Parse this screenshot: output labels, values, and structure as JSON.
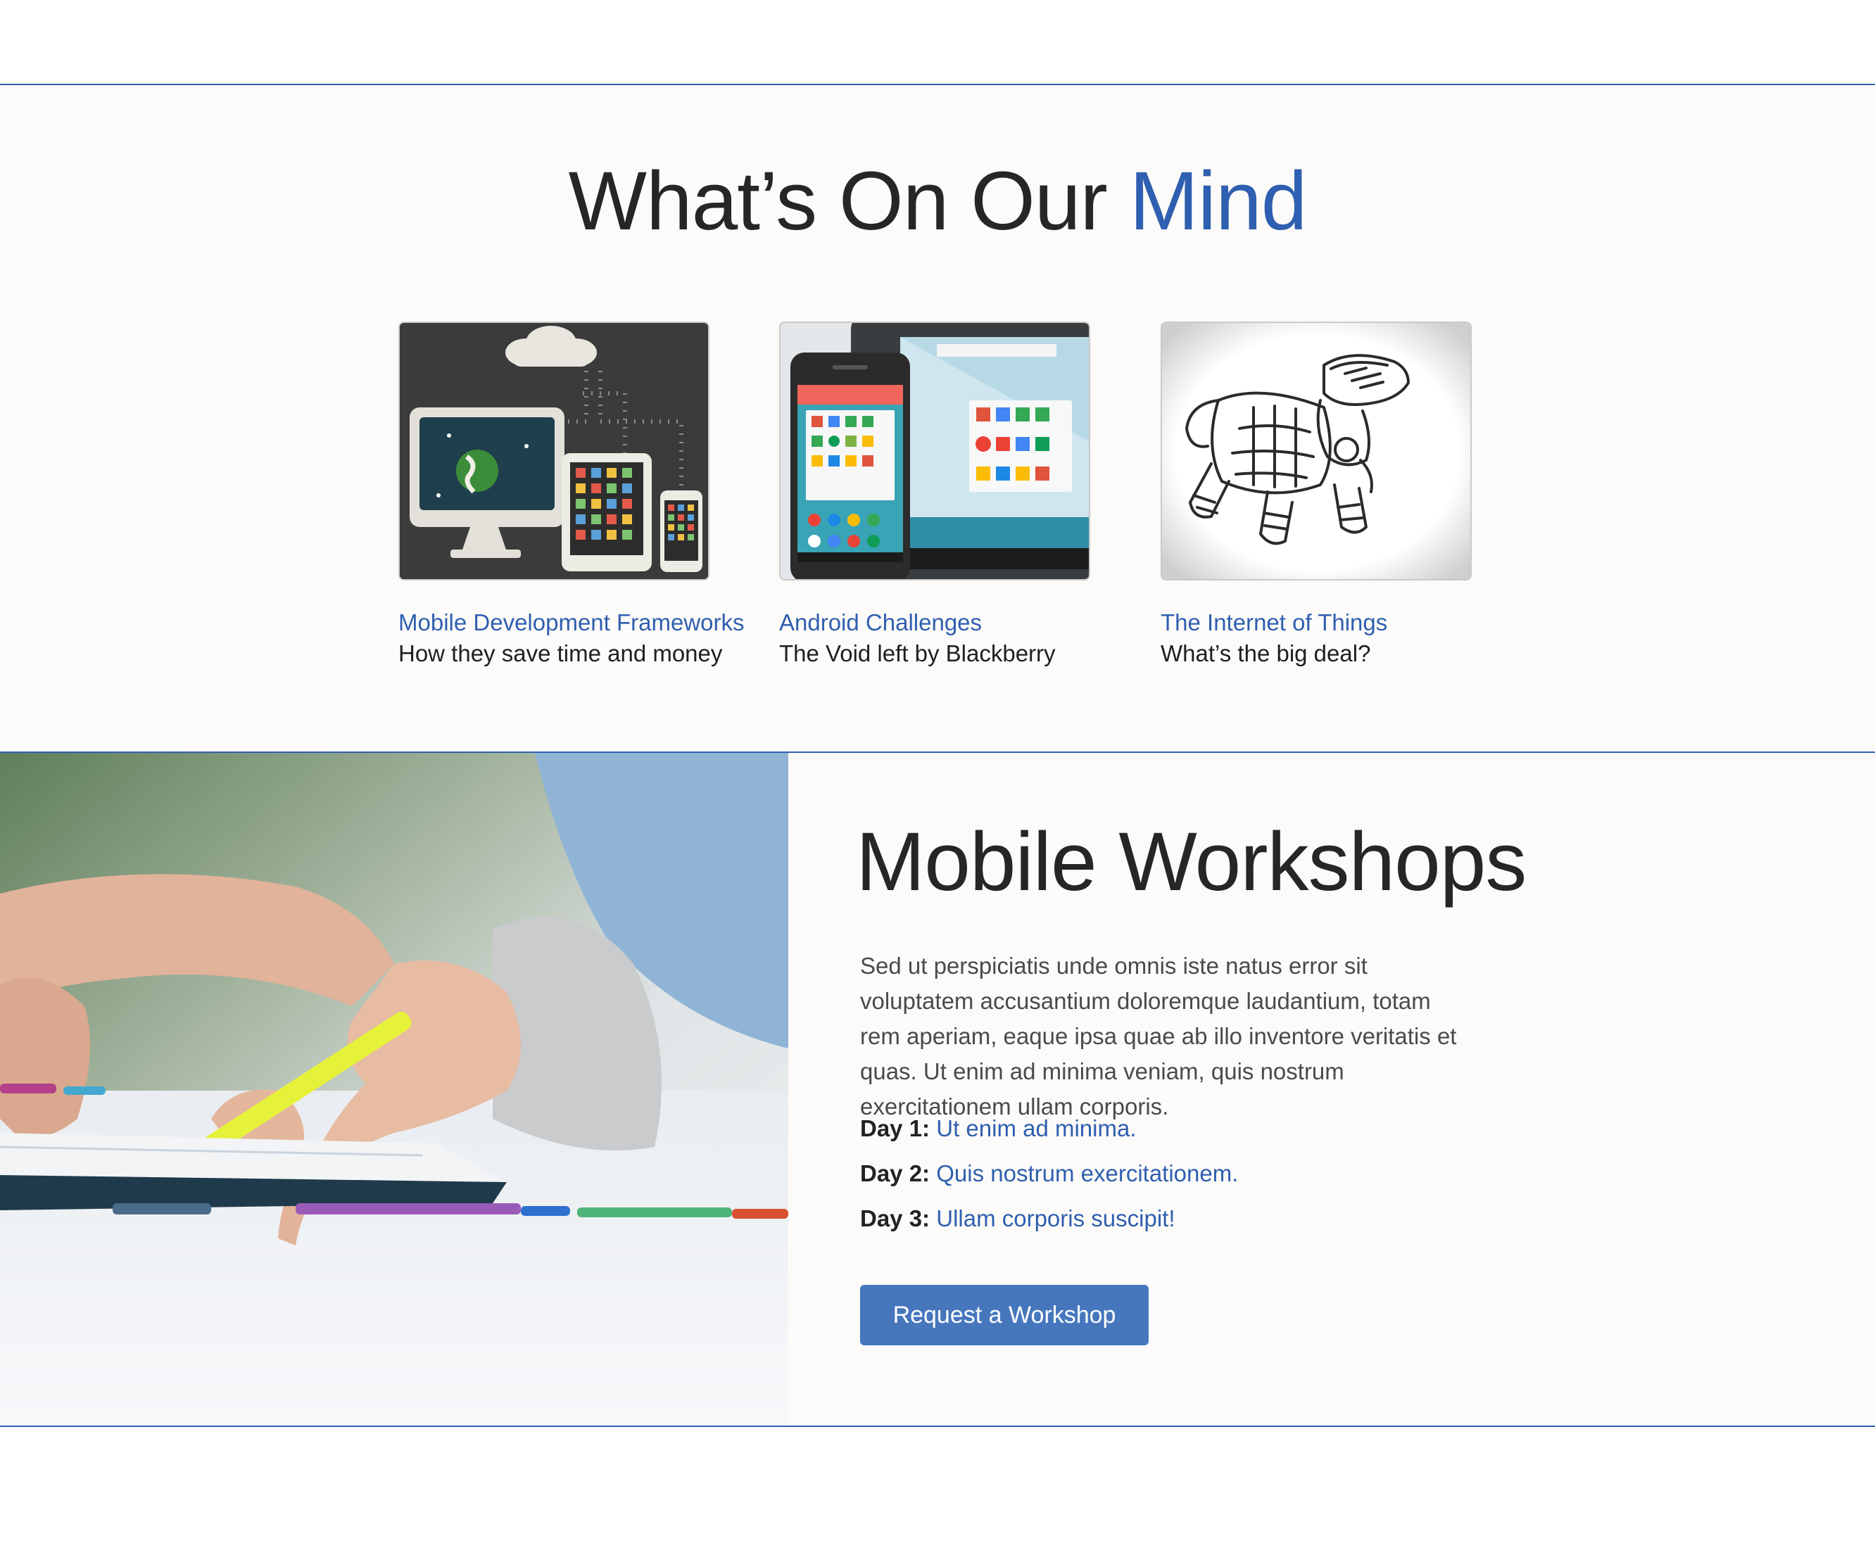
{
  "mind": {
    "title_main": "What’s On Our ",
    "title_accent": "Mind",
    "cards": [
      {
        "title": "Mobile Development Frameworks",
        "subtitle": "How they save time and money",
        "image": "devices-cloud-illustration"
      },
      {
        "title": "Android Challenges",
        "subtitle": "The Void left by Blackberry",
        "image": "android-phone-tablet"
      },
      {
        "title": "The Internet of Things",
        "subtitle": "What’s the big deal?",
        "image": "robot-dog-sketch"
      }
    ]
  },
  "workshops": {
    "title": "Mobile Workshops",
    "body": "Sed ut perspiciatis unde omnis iste natus error sit voluptatem accusantium doloremque laudantium, totam rem aperiam, eaque ipsa quae ab illo inventore veritatis et quas. Ut enim ad minima veniam, quis nostrum exercitationem ullam corporis.",
    "days": [
      {
        "label": "Day 1:",
        "text": "Ut enim ad minima."
      },
      {
        "label": "Day 2:",
        "text": "Quis nostrum exercitationem."
      },
      {
        "label": "Day 3:",
        "text": "Ullam corporis suscipit!"
      }
    ],
    "button_label": "Request a Workshop",
    "photo": "hands-highlighter-notebook"
  },
  "colors": {
    "accent": "#2f5fb0",
    "button": "#4677bd",
    "background": "#fcfbf9"
  }
}
